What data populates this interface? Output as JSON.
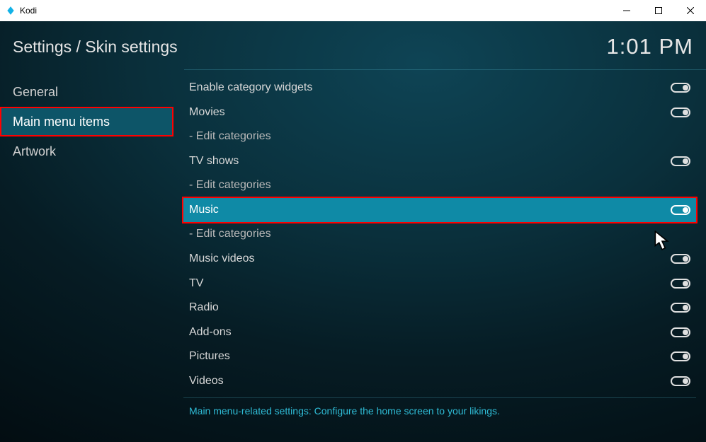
{
  "window": {
    "title": "Kodi"
  },
  "header": {
    "breadcrumb": "Settings / Skin settings",
    "clock": "1:01 PM"
  },
  "sidebar": {
    "items": [
      {
        "label": "General",
        "active": false
      },
      {
        "label": "Main menu items",
        "active": true,
        "highlighted": true
      },
      {
        "label": "Artwork",
        "active": false
      }
    ]
  },
  "settings": [
    {
      "label": "Enable category widgets",
      "toggle": "on"
    },
    {
      "label": "Movies",
      "toggle": "on"
    },
    {
      "label": "- Edit categories",
      "sub": true
    },
    {
      "label": "TV shows",
      "toggle": "on"
    },
    {
      "label": "- Edit categories",
      "sub": true
    },
    {
      "label": "Music",
      "toggle": "on",
      "selected": true
    },
    {
      "label": "- Edit categories",
      "sub": true
    },
    {
      "label": "Music videos",
      "toggle": "on"
    },
    {
      "label": "TV",
      "toggle": "on"
    },
    {
      "label": "Radio",
      "toggle": "on"
    },
    {
      "label": "Add-ons",
      "toggle": "on"
    },
    {
      "label": "Pictures",
      "toggle": "on"
    },
    {
      "label": "Videos",
      "toggle": "on"
    }
  ],
  "description": "Main menu-related settings: Configure the home screen to your likings."
}
